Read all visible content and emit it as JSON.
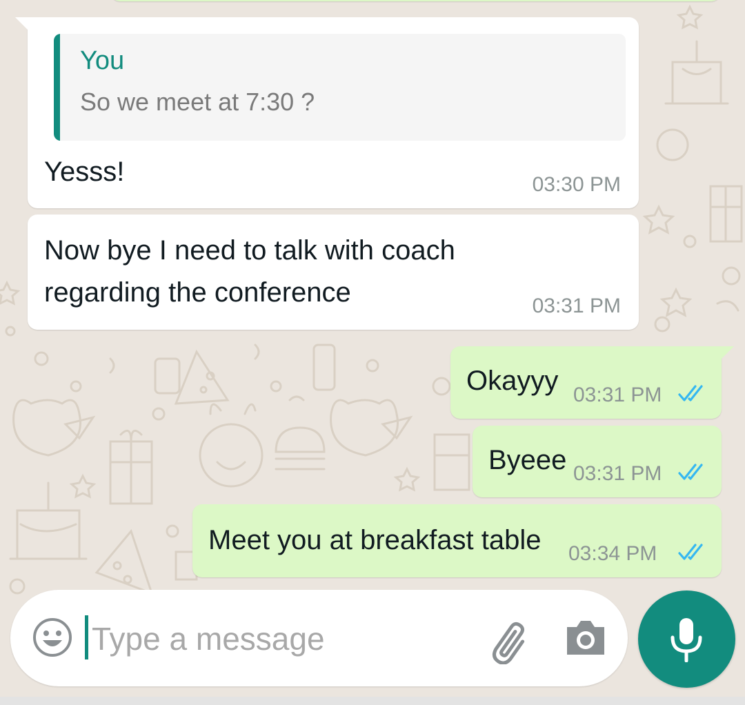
{
  "colors": {
    "accent": "#128c7e",
    "incoming_bubble": "#ffffff",
    "outgoing_bubble": "#dcf8c6",
    "read_ticks": "#34b7f1",
    "timestamp": "#8c9494",
    "wallpaper": "#ebe5de"
  },
  "messages": [
    {
      "direction": "incoming",
      "reply_to": {
        "author": "You",
        "text": "So we meet at 7:30 ?"
      },
      "text": "Yesss!",
      "time": "03:30 PM"
    },
    {
      "direction": "incoming",
      "text_line1": "Now bye I need to talk with coach",
      "text_line2": "regarding the conference",
      "time": "03:31 PM"
    },
    {
      "direction": "outgoing",
      "text": "Okayyy",
      "time": "03:31 PM",
      "status": "read"
    },
    {
      "direction": "outgoing",
      "text": "Byeee",
      "time": "03:31 PM",
      "status": "read"
    },
    {
      "direction": "outgoing",
      "text": "Meet you at breakfast table",
      "time": "03:34 PM",
      "status": "read"
    }
  ],
  "composer": {
    "placeholder": "Type a message",
    "emoji_icon": "emoji-icon",
    "attach_icon": "paperclip-icon",
    "camera_icon": "camera-icon",
    "mic_icon": "microphone-icon"
  }
}
